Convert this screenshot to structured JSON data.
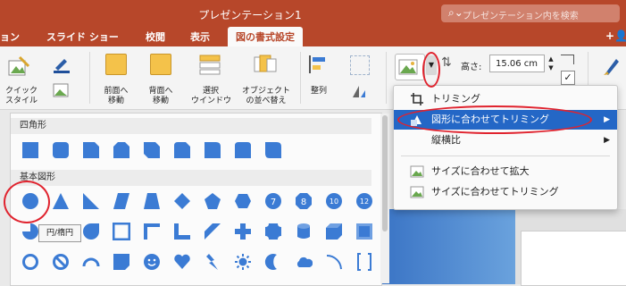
{
  "title": "プレゼンテーション1",
  "search": {
    "placeholder": "プレゼンテーション内を検索"
  },
  "tabs": [
    {
      "label": "ョン"
    },
    {
      "label": "スライド ショー"
    },
    {
      "label": "校閲"
    },
    {
      "label": "表示"
    },
    {
      "label": "図の書式設定"
    }
  ],
  "share_icon": "add-person-icon",
  "ribbon": {
    "quick_style": "クイック\nスタイル",
    "bring_forward": "前面へ\n移動",
    "send_backward": "背面へ\n移動",
    "selection_pane": "選択\nウインドウ",
    "reorder_objects": "オブジェクト\nの並べ替え",
    "align": "整列",
    "height_label": "高さ:",
    "height_value": "15.06 cm"
  },
  "gallery": {
    "section_rect": "四角形",
    "section_basic": "基本図形",
    "shape_labels": [
      "7",
      "8",
      "10",
      "12"
    ],
    "tooltip": "円/楕円"
  },
  "menu": {
    "items": [
      {
        "label": "トリミング",
        "icon": "crop-icon"
      },
      {
        "label": "図形に合わせてトリミング",
        "icon": "shape-crop-icon",
        "submenu": true
      },
      {
        "label": "縦横比",
        "icon": "none",
        "submenu": true
      },
      {
        "label": "サイズに合わせて拡大",
        "icon": "picture-icon"
      },
      {
        "label": "サイズに合わせてトリミング",
        "icon": "picture-icon"
      }
    ]
  },
  "colors": {
    "accent": "#b7472a",
    "highlight": "#2467c6",
    "shape_fill": "#3b7bd4",
    "annotation": "#e0232e"
  }
}
